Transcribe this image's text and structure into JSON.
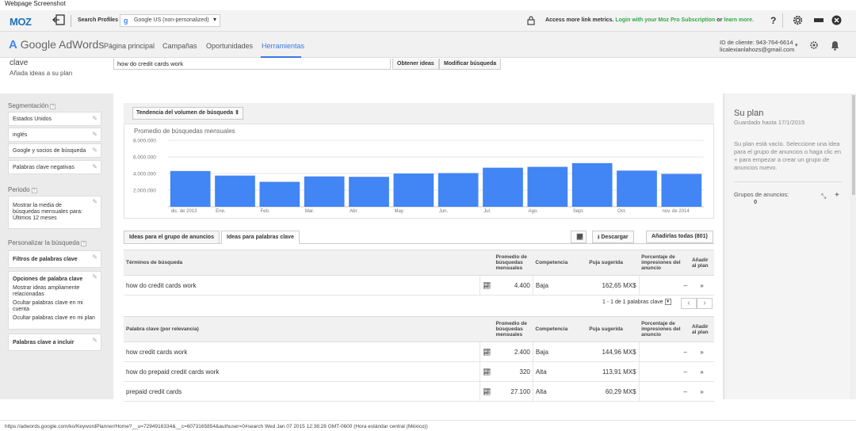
{
  "caption": "Webpage Screenshot",
  "mozbar": {
    "logo": "MOZ",
    "search_profiles_label": "Search Profiles",
    "profile_value": "Google US (non-personalized)",
    "access_text": "Access more link metrics.",
    "login_link": "Login with your Moz Pro Subscription",
    "or_text": "or",
    "learn_more": "learn more.",
    "help_label": "?"
  },
  "adwords": {
    "logo_google": "Google",
    "logo_adwords": "AdWords",
    "nav": [
      "Página principal",
      "Campañas",
      "Oportunidades",
      "Herramientas"
    ],
    "client_id": "ID de cliente: 943-764-6614",
    "email": "licalexianlahozs@gmail.com"
  },
  "search": {
    "title": "clave",
    "subtitle": "Añada ideas a su plan",
    "query": "how do credit cards work",
    "get_ideas": "Obtener ideas",
    "modify": "Modificar búsqueda"
  },
  "sidebar": {
    "segmentation_label": "Segmentación",
    "segmentation": [
      "Estados Unidos",
      "inglés",
      "Google y socios de búsqueda",
      "Palabras clave negativas"
    ],
    "period_label": "Periodo",
    "period_text": "Mostrar la media de búsquedas mensuales para: Últimos 12 meses",
    "customize_label": "Personalizar la búsqueda",
    "filters": "Filtros de palabras clave",
    "keyword_options": "Opciones de palabra clave",
    "keyword_options_items": [
      "Mostrar ideas ampliamente relacionadas",
      "Ocultar palabras clave en mi cuenta",
      "Ocultar palabras clave en mi plan"
    ],
    "include": "Palabras clave a incluir"
  },
  "chart_data": {
    "type": "bar",
    "title": "Promedio de búsquedas mensuales",
    "selector": "Tendencia del volumen de búsqueda",
    "categories": [
      "dic. de 2013",
      "Ene.",
      "Feb.",
      "Mar.",
      "Abr.",
      "May.",
      "Jun.",
      "Jul.",
      "Ago.",
      "Sept.",
      "Oct.",
      "nov. de 2014"
    ],
    "values": [
      4300000,
      3750000,
      3000000,
      3650000,
      3600000,
      4000000,
      4050000,
      4700000,
      4800000,
      5250000,
      4350000,
      3950000
    ],
    "yticks": [
      "8.000.000",
      "6.000.000",
      "4.000.000",
      "2.000.000"
    ],
    "ylim": [
      0,
      8000000
    ],
    "grid": true,
    "color": "#4285f4"
  },
  "tabs": {
    "ad_groups": "Ideas para el grupo de anuncios",
    "keywords": "Ideas para palabras clave",
    "download": "Descargar",
    "add_all": "Añadirlas todas (801)"
  },
  "table1": {
    "headers": [
      "Términos de búsqueda",
      "Promedio de búsquedas mensuales",
      "Competencia",
      "Puja sugerida",
      "Porcentaje de impresiones del anuncio",
      "Añadir al plan"
    ],
    "rows": [
      {
        "term": "how do credit cards work",
        "avg": "4.400",
        "comp": "Baja",
        "bid": "162,65 MX$",
        "share": "–"
      }
    ]
  },
  "pager": "1 - 1 de 1 palabras clave",
  "table2": {
    "headers": [
      "Palabra clave (por relevancia)",
      "Promedio de búsquedas mensuales",
      "Competencia",
      "Puja sugerida",
      "Porcentaje de impresiones del anuncio",
      "Añadir al plan"
    ],
    "rows": [
      {
        "term": "how credit cards work",
        "avg": "2.400",
        "comp": "Baja",
        "bid": "144,96 MX$",
        "share": "–"
      },
      {
        "term": "how do prepaid credit cards work",
        "avg": "320",
        "comp": "Alta",
        "bid": "113,91 MX$",
        "share": "–"
      },
      {
        "term": "prepaid credit cards",
        "avg": "27.100",
        "comp": "Alta",
        "bid": "60,29 MX$",
        "share": "–"
      }
    ]
  },
  "plan": {
    "title": "Su plan",
    "saved": "Guardado hasta 17/1/2015",
    "desc": "Su plan está vacío. Seleccione una idea para el grupo de anuncios o haga clic en + para empezar a crear un grupo de anuncios nuevo.",
    "groups_label": "Grupos de anuncios:",
    "groups_count": "0"
  },
  "status": "https://adwords.google.com/ko/KeywordPlanner/Home?__u=7294916334&__c=6073165854&authuser=0#search Wed Jan 07 2015 12:38:28 GMT-0600 (Hora estándar central (México))"
}
